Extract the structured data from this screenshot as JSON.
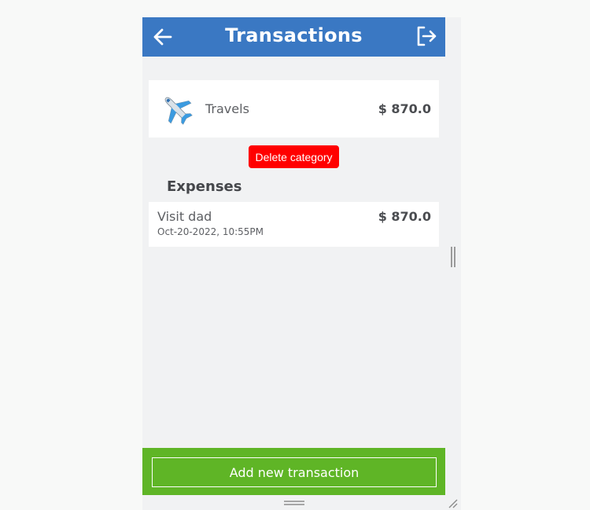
{
  "header": {
    "title": "Transactions",
    "back_icon": "arrow-left-icon",
    "logout_icon": "logout-icon"
  },
  "category": {
    "icon": "airplane-icon",
    "name": "Travels",
    "total": "$ 870.0"
  },
  "delete_button": {
    "label": "Delete category"
  },
  "expenses": {
    "title": "Expenses",
    "items": [
      {
        "name": "Visit dad",
        "date": "Oct-20-2022, 10:55PM",
        "amount": "$ 870.0"
      }
    ]
  },
  "footer": {
    "add_button_label": "Add new transaction"
  },
  "colors": {
    "header": "#3a78c3",
    "footer": "#5fb526",
    "delete": "#ff0000",
    "background": "#f1f2f3"
  }
}
